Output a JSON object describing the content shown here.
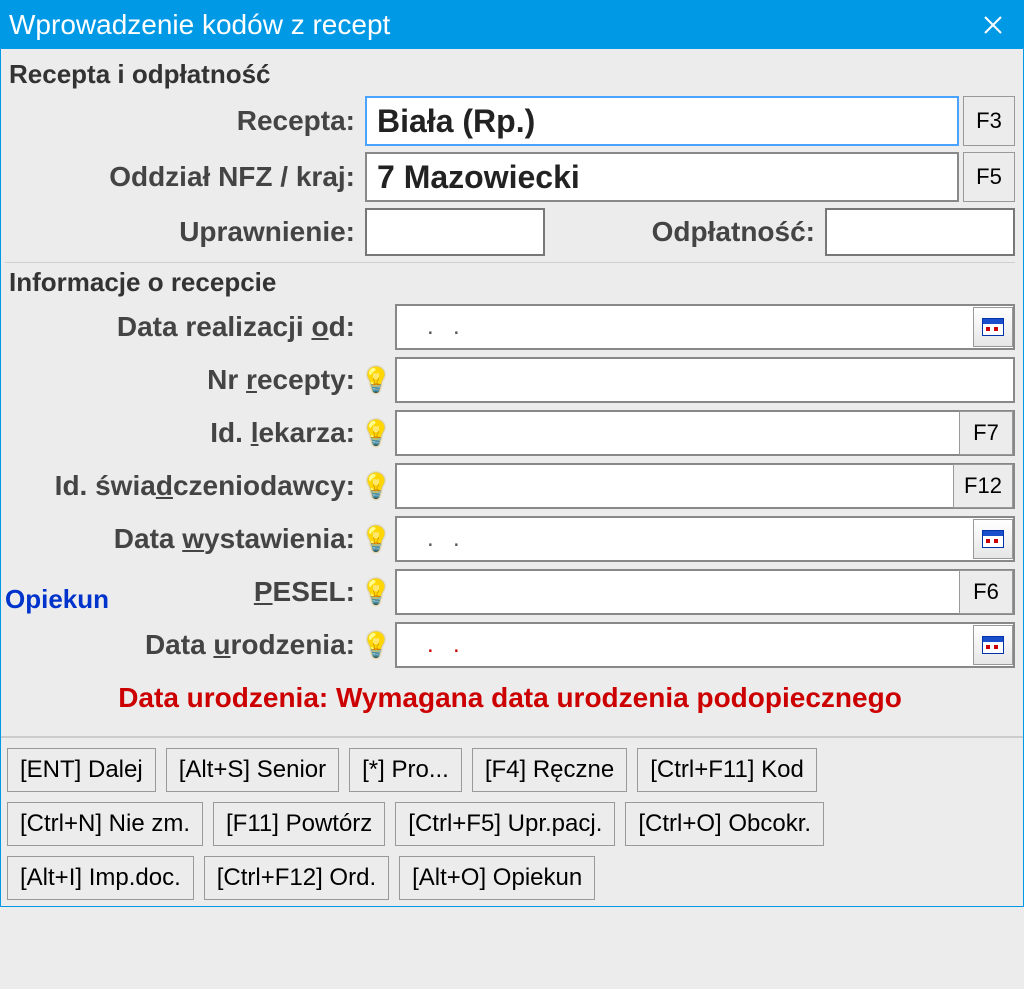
{
  "window": {
    "title": "Wprowadzenie kodów z recept"
  },
  "section1": {
    "title": "Recepta i odpłatność",
    "recepta_label": "Recepta:",
    "recepta_value": "Biała (Rp.)",
    "recepta_fkey": "F3",
    "oddzial_label": "Oddział NFZ / kraj:",
    "oddzial_value": "7 Mazowiecki",
    "oddzial_fkey": "F5",
    "upraw_label": "Uprawnienie:",
    "upraw_value": "",
    "odpl_label": "Odpłatność:",
    "odpl_value": ""
  },
  "section2": {
    "title": "Informacje o recepcie",
    "data_od_label": "Data realizacji od:",
    "data_od_value": ".  .",
    "nr_recepty_label": "Nr recepty:",
    "nr_recepty_value": "",
    "id_lekarza_label": "Id. lekarza:",
    "id_lekarza_value": "",
    "id_lekarza_fkey": "F7",
    "id_swiad_label": "Id. świadczeniodawcy:",
    "id_swiad_value": "",
    "id_swiad_fkey": "F12",
    "data_wyst_label": "Data wystawienia:",
    "data_wyst_value": ".  .",
    "opiekun_link": "Opiekun",
    "pesel_label": "PESEL:",
    "pesel_value": "",
    "pesel_fkey": "F6",
    "data_ur_label": "Data urodzenia:",
    "data_ur_value": ".  ."
  },
  "error": "Data urodzenia: Wymagana data urodzenia podopiecznego",
  "buttons": [
    "[ENT] Dalej",
    "[Alt+S] Senior",
    "[*] Pro...",
    "[F4] Ręczne",
    "[Ctrl+F11] Kod",
    "[Ctrl+N] Nie zm.",
    "[F11] Powtórz",
    "[Ctrl+F5] Upr.pacj.",
    "[Ctrl+O] Obcokr.",
    "[Alt+I] Imp.doc.",
    "[Ctrl+F12] Ord.",
    "[Alt+O] Opiekun"
  ]
}
